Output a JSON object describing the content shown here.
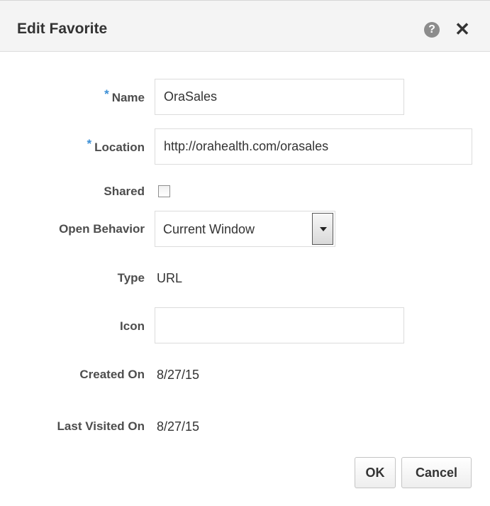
{
  "dialog": {
    "title": "Edit Favorite",
    "help_label": "?",
    "close_label": "✕"
  },
  "form": {
    "required_marker": "*",
    "name_label": "Name",
    "name_value": "OraSales",
    "location_label": "Location",
    "location_value": "http://orahealth.com/orasales",
    "shared_label": "Shared",
    "shared_checked": false,
    "open_behavior_label": "Open Behavior",
    "open_behavior_value": "Current Window",
    "type_label": "Type",
    "type_value": "URL",
    "icon_label": "Icon",
    "icon_value": "",
    "created_on_label": "Created On",
    "created_on_value": "8/27/15",
    "last_visited_label": "Last Visited On",
    "last_visited_value": "8/27/15"
  },
  "buttons": {
    "ok_label": "OK",
    "cancel_label": "Cancel"
  },
  "colors": {
    "required_marker": "#3b8fd6",
    "titlebar_bg": "#f4f4f4",
    "help_icon_bg": "#8c8c8c"
  },
  "icons": {
    "help": "help-circle-icon",
    "close": "close-icon",
    "dropdown": "chevron-down-icon"
  }
}
